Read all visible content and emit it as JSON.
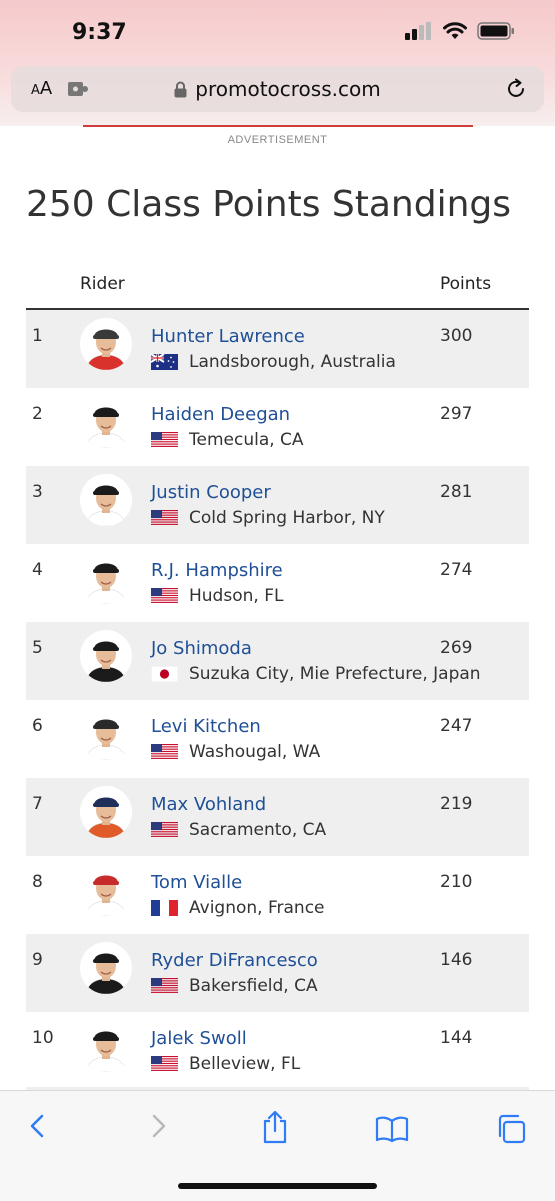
{
  "status_bar": {
    "time": "9:37"
  },
  "browser": {
    "text_size_label": "AA",
    "domain": "promotocross.com"
  },
  "ad_label": "ADVERTISEMENT",
  "page": {
    "title": "250 Class Points Standings",
    "columns": {
      "rider": "Rider",
      "points": "Points"
    }
  },
  "standings": [
    {
      "pos": "1",
      "name": "Hunter Lawrence",
      "hometown": "Landsborough, Australia",
      "flag": "australia-flag",
      "points": "300"
    },
    {
      "pos": "2",
      "name": "Haiden Deegan",
      "hometown": "Temecula, CA",
      "flag": "usa-flag",
      "points": "297"
    },
    {
      "pos": "3",
      "name": "Justin Cooper",
      "hometown": "Cold Spring Harbor, NY",
      "flag": "usa-flag",
      "points": "281"
    },
    {
      "pos": "4",
      "name": "R.J. Hampshire",
      "hometown": "Hudson, FL",
      "flag": "usa-flag",
      "points": "274"
    },
    {
      "pos": "5",
      "name": "Jo Shimoda",
      "hometown": "Suzuka City, Mie Prefecture, Japan",
      "flag": "japan-flag",
      "points": "269"
    },
    {
      "pos": "6",
      "name": "Levi Kitchen",
      "hometown": "Washougal, WA",
      "flag": "usa-flag",
      "points": "247"
    },
    {
      "pos": "7",
      "name": "Max Vohland",
      "hometown": "Sacramento, CA",
      "flag": "usa-flag",
      "points": "219"
    },
    {
      "pos": "8",
      "name": "Tom Vialle",
      "hometown": "Avignon, France",
      "flag": "france-flag",
      "points": "210"
    },
    {
      "pos": "9",
      "name": "Ryder DiFrancesco",
      "hometown": "Bakersfield, CA",
      "flag": "usa-flag",
      "points": "146"
    },
    {
      "pos": "10",
      "name": "Jalek Swoll",
      "hometown": "Belleview, FL",
      "flag": "usa-flag",
      "points": "144"
    }
  ],
  "avatars": [
    {
      "cap": "#3a3a3a",
      "jersey": "#d9322c"
    },
    {
      "cap": "#1b1b1b",
      "jersey": "#ffffff"
    },
    {
      "cap": "#1b1b1b",
      "jersey": "#ffffff"
    },
    {
      "cap": "#1b1b1b",
      "jersey": "#ffffff"
    },
    {
      "cap": "#1b1b1b",
      "jersey": "#1b1b1b"
    },
    {
      "cap": "#2a2a2a",
      "jersey": "#ffffff"
    },
    {
      "cap": "#1f2f5a",
      "jersey": "#e05a2a"
    },
    {
      "cap": "#c82b2b",
      "jersey": "#ffffff"
    },
    {
      "cap": "#1b1b1b",
      "jersey": "#1b1b1b"
    },
    {
      "cap": "#1b1b1b",
      "jersey": "#ffffff"
    }
  ],
  "colors": {
    "link": "#1f4f96",
    "row_shade": "#efefef",
    "accent_red": "#d23c3c",
    "ios_blue": "#2f7cf6"
  },
  "icons": {
    "status": [
      "signal-icon",
      "wifi-icon",
      "battery-icon"
    ],
    "toolbar": [
      "back-icon",
      "forward-icon",
      "share-icon",
      "bookmarks-icon",
      "tabs-icon"
    ]
  }
}
